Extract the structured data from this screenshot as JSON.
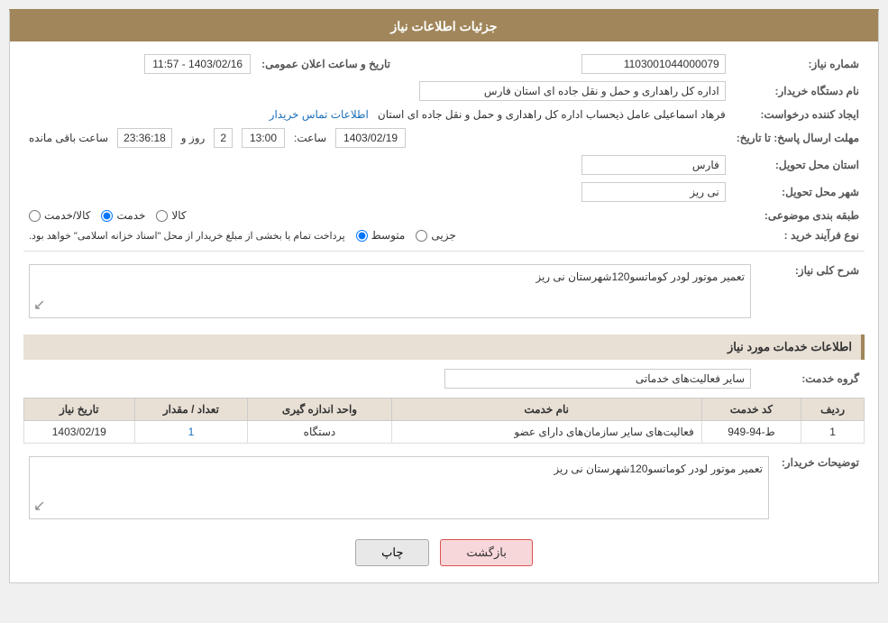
{
  "header": {
    "title": "جزئیات اطلاعات نیاز"
  },
  "fields": {
    "request_number_label": "شماره نیاز:",
    "request_number_value": "1103001044000079",
    "buyer_org_label": "نام دستگاه خریدار:",
    "buyer_org_value": "اداره کل راهداری و حمل و نقل جاده ای استان فارس",
    "creator_label": "ایجاد کننده درخواست:",
    "creator_name": "فرهاد اسماعیلی عامل ذیحساب اداره کل راهداری و حمل و نقل جاده ای استان",
    "creator_link": "اطلاعات تماس خریدار",
    "deadline_label": "مهلت ارسال پاسخ: تا تاریخ:",
    "deadline_date": "1403/02/19",
    "deadline_time_label": "ساعت:",
    "deadline_time": "13:00",
    "remaining_days_label": "روز و",
    "remaining_days": "2",
    "remaining_time_label": "ساعت باقی مانده",
    "remaining_time": "23:36:18",
    "announce_label": "تاریخ و ساعت اعلان عمومی:",
    "announce_value": "1403/02/16 - 11:57",
    "province_label": "استان محل تحویل:",
    "province_value": "فارس",
    "city_label": "شهر محل تحویل:",
    "city_value": "نی ریز",
    "category_label": "طبقه بندی موضوعی:",
    "category_options": [
      {
        "label": "کالا",
        "selected": false
      },
      {
        "label": "خدمت",
        "selected": true
      },
      {
        "label": "کالا/خدمت",
        "selected": false
      }
    ],
    "purchase_type_label": "نوع فرآیند خرید :",
    "purchase_type_options": [
      {
        "label": "جزیی",
        "selected": false
      },
      {
        "label": "متوسط",
        "selected": true
      }
    ],
    "purchase_type_note": "پرداخت تمام یا بخشی از مبلغ خریدار از محل \"اسناد خزانه اسلامی\" خواهد بود.",
    "description_label": "شرح کلی نیاز:",
    "description_value": "تعمیر موتور لودر کوماتسو120شهرستان نی ریز",
    "services_section": "اطلاعات خدمات مورد نیاز",
    "service_group_label": "گروه خدمت:",
    "service_group_value": "سایر فعالیت‌های خدماتی",
    "table": {
      "columns": [
        "ردیف",
        "کد خدمت",
        "نام خدمت",
        "واحد اندازه گیری",
        "تعداد / مقدار",
        "تاریخ نیاز"
      ],
      "rows": [
        {
          "row": "1",
          "code": "ط-94-949",
          "name": "فعالیت‌های سایر سازمان‌های دارای عضو",
          "unit": "دستگاه",
          "quantity": "1",
          "date": "1403/02/19"
        }
      ]
    },
    "buyer_description_label": "توضیحات خریدار:",
    "buyer_description_value": "تعمیر موتور لودر کوماتسو120شهرستان نی ریز"
  },
  "buttons": {
    "print": "چاپ",
    "back": "بازگشت"
  }
}
